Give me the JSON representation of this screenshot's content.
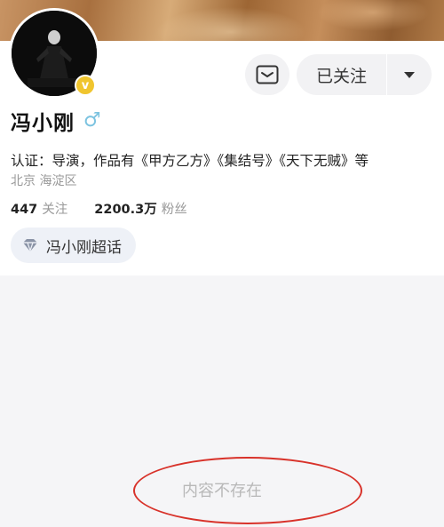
{
  "profile": {
    "name": "冯小刚",
    "gender_symbol": "♂",
    "verified_mark": "v",
    "verification": "认证：导演，作品有《甲方乙方》《集结号》《天下无贼》等",
    "location": "北京 海淀区",
    "following_count": "447",
    "following_label": "关注",
    "followers_count": "2200.3万",
    "followers_label": "粉丝"
  },
  "actions": {
    "follow_label": "已关注"
  },
  "supertopic": {
    "label": "冯小刚超话"
  },
  "content": {
    "empty_text": "内容不存在"
  },
  "colors": {
    "verified_badge": "#f0c52e",
    "gender": "#7cc3e0",
    "annotation": "#d8322a"
  },
  "icons": {
    "message": "envelope-icon",
    "dropdown": "caret-down-icon",
    "supertopic": "diamond-icon"
  }
}
